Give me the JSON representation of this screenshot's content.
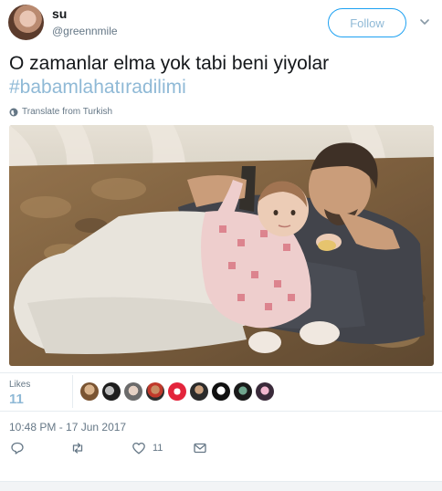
{
  "author": {
    "name": "su",
    "handle": "@greennmile"
  },
  "header": {
    "follow_label": "Follow",
    "caret_icon": "chevron-down-icon"
  },
  "tweet": {
    "text": "O zamanlar elma yok tabi beni yiyolar",
    "hashtag": "#babamlahatıradilimi",
    "translate_label": "Translate from Turkish"
  },
  "stats": {
    "likes_label": "Likes",
    "likes_count": "11",
    "liker_count": 9
  },
  "timestamp": "10:48 PM - 17 Jun 2017",
  "actions": {
    "reply_icon": "reply-icon",
    "retweet_icon": "retweet-icon",
    "like_icon": "heart-icon",
    "like_count": "11",
    "dm_icon": "envelope-icon"
  },
  "colors": {
    "accent": "#1da1f2",
    "muted_link": "#8fb9d6",
    "secondary_text": "#657786",
    "border": "#e6ecf0"
  }
}
